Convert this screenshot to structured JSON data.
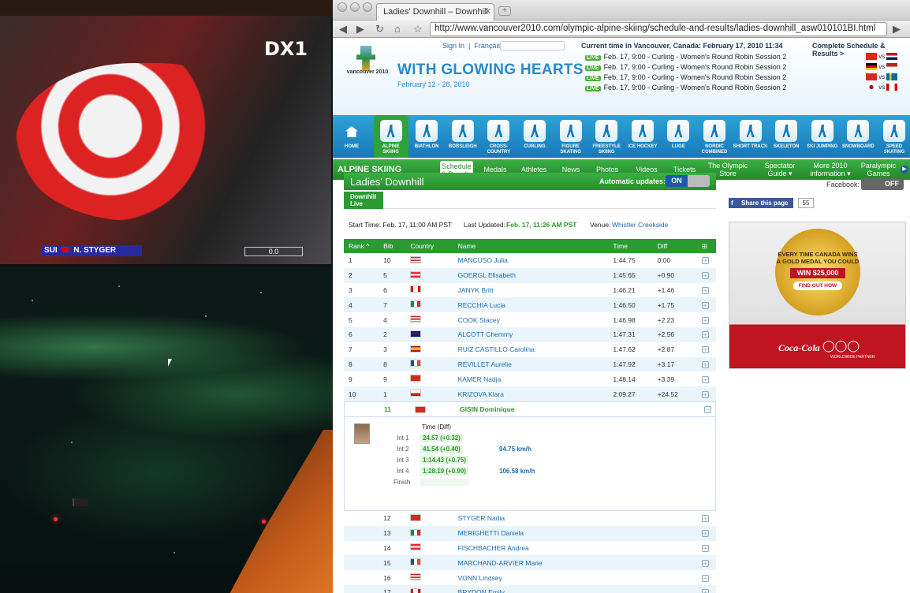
{
  "tv": {
    "channel_bug": "DX1",
    "athlete_name": "N. STYGER",
    "country_code": "SUI",
    "timer": "0.0"
  },
  "browser": {
    "tab_title": "Ladies' Downhill – Downhill",
    "url": "http://www.vancouver2010.com/olympic-alpine-skiing/schedule-and-results/ladies-downhill_asw010101BI.html"
  },
  "header": {
    "sign_in": "Sign In",
    "francais": "Français",
    "tagline": "WITH GLOWING HEARTS",
    "dates": "February 12 - 28, 2010",
    "logo_text": "vancouver 2010",
    "current_time": "Current time in Vancouver, Canada: February 17, 2010 11:34",
    "complete_schedule": "Complete Schedule & Results >",
    "live_tag": "LIVE",
    "live_events": [
      {
        "text": "Feb. 17, 9:00 - Curling - Women's Round Robin Session 2",
        "vs": "vs"
      },
      {
        "text": "Feb. 17, 9:00 - Curling - Women's Round Robin Session 2",
        "vs": "vs"
      },
      {
        "text": "Feb. 17, 9:00 - Curling - Women's Round Robin Session 2",
        "vs": "vs"
      },
      {
        "text": "Feb. 17, 9:00 - Curling - Women's Round Robin Session 2",
        "vs": "vs"
      }
    ]
  },
  "sports": [
    {
      "label": "HOME",
      "icon": "home-icon"
    },
    {
      "label": "ALPINE SKIING",
      "icon": "alpine-skiing-icon"
    },
    {
      "label": "BIATHLON",
      "icon": "biathlon-icon"
    },
    {
      "label": "BOBSLEIGH",
      "icon": "bobsleigh-icon"
    },
    {
      "label": "CROSS-COUNTRY",
      "icon": "cross-country-icon"
    },
    {
      "label": "CURLING",
      "icon": "curling-icon"
    },
    {
      "label": "FIGURE SKATING",
      "icon": "figure-skating-icon"
    },
    {
      "label": "FREESTYLE SKIING",
      "icon": "freestyle-skiing-icon"
    },
    {
      "label": "ICE HOCKEY",
      "icon": "ice-hockey-icon"
    },
    {
      "label": "LUGE",
      "icon": "luge-icon"
    },
    {
      "label": "NORDIC COMBINED",
      "icon": "nordic-combined-icon"
    },
    {
      "label": "SHORT TRACK",
      "icon": "short-track-icon"
    },
    {
      "label": "SKELETON",
      "icon": "skeleton-icon"
    },
    {
      "label": "SKI JUMPING",
      "icon": "ski-jumping-icon"
    },
    {
      "label": "SNOWBOARD",
      "icon": "snowboard-icon"
    },
    {
      "label": "SPEED SKATING",
      "icon": "speed-skating-icon"
    }
  ],
  "menu": {
    "title": "ALPINE SKIING",
    "items": [
      "Schedule & Results",
      "Medals",
      "Athletes",
      "News",
      "Photos",
      "Videos",
      "Tickets",
      "The Olympic Store",
      "Spectator Guide ▾",
      "More 2010 information ▾",
      "Paralympic Games"
    ]
  },
  "event": {
    "title": "Ladies' Downhill",
    "auto_updates": "Automatic updates:",
    "toggle_on": "ON",
    "subtab": "Downhill Live",
    "start_time": "Start Time: Feb. 17, 11:00 AM PST",
    "last_updated_label": "Last Updated:",
    "last_updated": "Feb. 17, 11:26 AM PST",
    "venue_label": "Venue:",
    "venue": "Whistler Creekside"
  },
  "results": {
    "headers": [
      "Rank",
      "Bib",
      "Country",
      "Name",
      "Time",
      "Diff"
    ],
    "rows": [
      {
        "rank": "1",
        "bib": "10",
        "country": "USA",
        "name": "MANCUSO Julia",
        "time": "1:44.75",
        "diff": "0.00"
      },
      {
        "rank": "2",
        "bib": "5",
        "country": "AUT",
        "name": "GOERGL Elisabeth",
        "time": "1:45.65",
        "diff": "+0.90"
      },
      {
        "rank": "3",
        "bib": "6",
        "country": "CAN",
        "name": "JANYK Britt",
        "time": "1:46.21",
        "diff": "+1.46"
      },
      {
        "rank": "4",
        "bib": "7",
        "country": "ITA",
        "name": "RECCHIA Lucia",
        "time": "1:46.50",
        "diff": "+1.75"
      },
      {
        "rank": "5",
        "bib": "4",
        "country": "USA",
        "name": "COOK Stacey",
        "time": "1:46.98",
        "diff": "+2.23"
      },
      {
        "rank": "6",
        "bib": "2",
        "country": "GBR",
        "name": "ALCOTT Chemmy",
        "time": "1:47.31",
        "diff": "+2.56"
      },
      {
        "rank": "7",
        "bib": "3",
        "country": "ESP",
        "name": "RUIZ CASTILLO Carolina",
        "time": "1:47.62",
        "diff": "+2.87"
      },
      {
        "rank": "8",
        "bib": "8",
        "country": "FRA",
        "name": "REVILLET Aurelie",
        "time": "1:47.92",
        "diff": "+3.17"
      },
      {
        "rank": "9",
        "bib": "9",
        "country": "SUI",
        "name": "KAMER Nadja",
        "time": "1:48.14",
        "diff": "+3.39"
      },
      {
        "rank": "10",
        "bib": "1",
        "country": "CZE",
        "name": "KRIZOVA Klara",
        "time": "2:09.27",
        "diff": "+24.52"
      }
    ],
    "live_row": {
      "bib": "11",
      "country": "SUI",
      "name": "GISIN Dominique"
    },
    "live_detail": {
      "time_diff_label": "Time (Diff)",
      "intervals": [
        {
          "label": "Int 1",
          "value": "24.57 (+0.32)",
          "speed": ""
        },
        {
          "label": "Int 2",
          "value": "41.54 (+0.40)",
          "speed": "94.75 km/h"
        },
        {
          "label": "Int 3",
          "value": "1:14.43 (+0.75)",
          "speed": ""
        },
        {
          "label": "Int 4",
          "value": "1:28.19 (+0.99)",
          "speed": "106.58 km/h"
        }
      ],
      "finish_label": "Finish"
    },
    "pending_rows": [
      {
        "bib": "12",
        "country": "SUI",
        "name": "STYGER Nadia"
      },
      {
        "bib": "13",
        "country": "ITA",
        "name": "MERIGHETTI Daniela"
      },
      {
        "bib": "14",
        "country": "AUT",
        "name": "FISCHBACHER Andrea"
      },
      {
        "bib": "15",
        "country": "FRA",
        "name": "MARCHAND-ARVIER Marie"
      },
      {
        "bib": "16",
        "country": "USA",
        "name": "VONN Lindsey"
      },
      {
        "bib": "17",
        "country": "CAN",
        "name": "BRYDON Emily"
      }
    ]
  },
  "sidebar": {
    "facebook_label": "Facebook:",
    "facebook_toggle": "OFF",
    "share_label": "Share this page",
    "share_count": "55",
    "ad": {
      "line1": "EVERY TIME CANADA WINS A GOLD MEDAL YOU COULD",
      "win": "WIN $25,000",
      "cta": "FIND OUT HOW",
      "brand": "Coca-Cola",
      "partner": "WORLDWIDE PARTNER"
    }
  },
  "colors": {
    "accent_green": "#2a9a32",
    "brand_blue": "#1878b8",
    "link_blue": "#1a6ab0"
  }
}
